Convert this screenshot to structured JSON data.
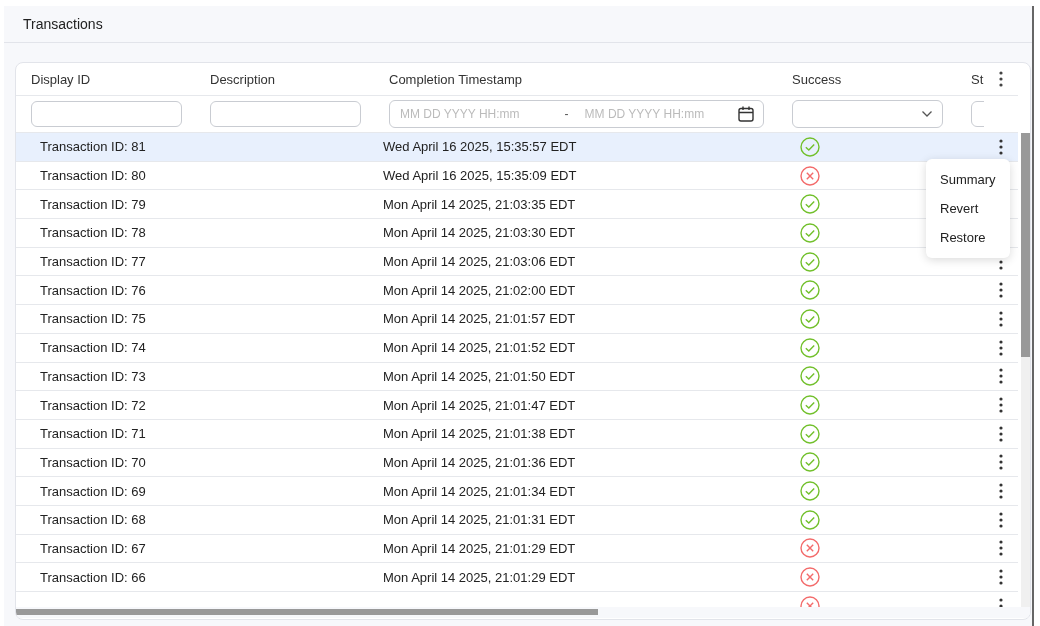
{
  "page": {
    "title": "Transactions"
  },
  "table": {
    "columns": [
      "Display ID",
      "Description",
      "Completion Timestamp",
      "Success",
      "St"
    ],
    "filters": {
      "date_from_placeholder": "MM DD YYYY HH:mm",
      "date_separator": "-",
      "date_to_placeholder": "MM DD YYYY HH:mm"
    },
    "rows": [
      {
        "id": "Transaction ID: 81",
        "timestamp": "Wed April 16 2025, 15:35:57 EDT",
        "success": true,
        "selected": true
      },
      {
        "id": "Transaction ID: 80",
        "timestamp": "Wed April 16 2025, 15:35:09 EDT",
        "success": false,
        "selected": false
      },
      {
        "id": "Transaction ID: 79",
        "timestamp": "Mon April 14 2025, 21:03:35 EDT",
        "success": true,
        "selected": false
      },
      {
        "id": "Transaction ID: 78",
        "timestamp": "Mon April 14 2025, 21:03:30 EDT",
        "success": true,
        "selected": false
      },
      {
        "id": "Transaction ID: 77",
        "timestamp": "Mon April 14 2025, 21:03:06 EDT",
        "success": true,
        "selected": false
      },
      {
        "id": "Transaction ID: 76",
        "timestamp": "Mon April 14 2025, 21:02:00 EDT",
        "success": true,
        "selected": false
      },
      {
        "id": "Transaction ID: 75",
        "timestamp": "Mon April 14 2025, 21:01:57 EDT",
        "success": true,
        "selected": false
      },
      {
        "id": "Transaction ID: 74",
        "timestamp": "Mon April 14 2025, 21:01:52 EDT",
        "success": true,
        "selected": false
      },
      {
        "id": "Transaction ID: 73",
        "timestamp": "Mon April 14 2025, 21:01:50 EDT",
        "success": true,
        "selected": false
      },
      {
        "id": "Transaction ID: 72",
        "timestamp": "Mon April 14 2025, 21:01:47 EDT",
        "success": true,
        "selected": false
      },
      {
        "id": "Transaction ID: 71",
        "timestamp": "Mon April 14 2025, 21:01:38 EDT",
        "success": true,
        "selected": false
      },
      {
        "id": "Transaction ID: 70",
        "timestamp": "Mon April 14 2025, 21:01:36 EDT",
        "success": true,
        "selected": false
      },
      {
        "id": "Transaction ID: 69",
        "timestamp": "Mon April 14 2025, 21:01:34 EDT",
        "success": true,
        "selected": false
      },
      {
        "id": "Transaction ID: 68",
        "timestamp": "Mon April 14 2025, 21:01:31 EDT",
        "success": true,
        "selected": false
      },
      {
        "id": "Transaction ID: 67",
        "timestamp": "Mon April 14 2025, 21:01:29 EDT",
        "success": false,
        "selected": false
      },
      {
        "id": "Transaction ID: 66",
        "timestamp": "Mon April 14 2025, 21:01:29 EDT",
        "success": false,
        "selected": false
      },
      {
        "success": false,
        "selected": false
      }
    ]
  },
  "row_menu": {
    "items": [
      "Summary",
      "Revert",
      "Restore"
    ]
  }
}
